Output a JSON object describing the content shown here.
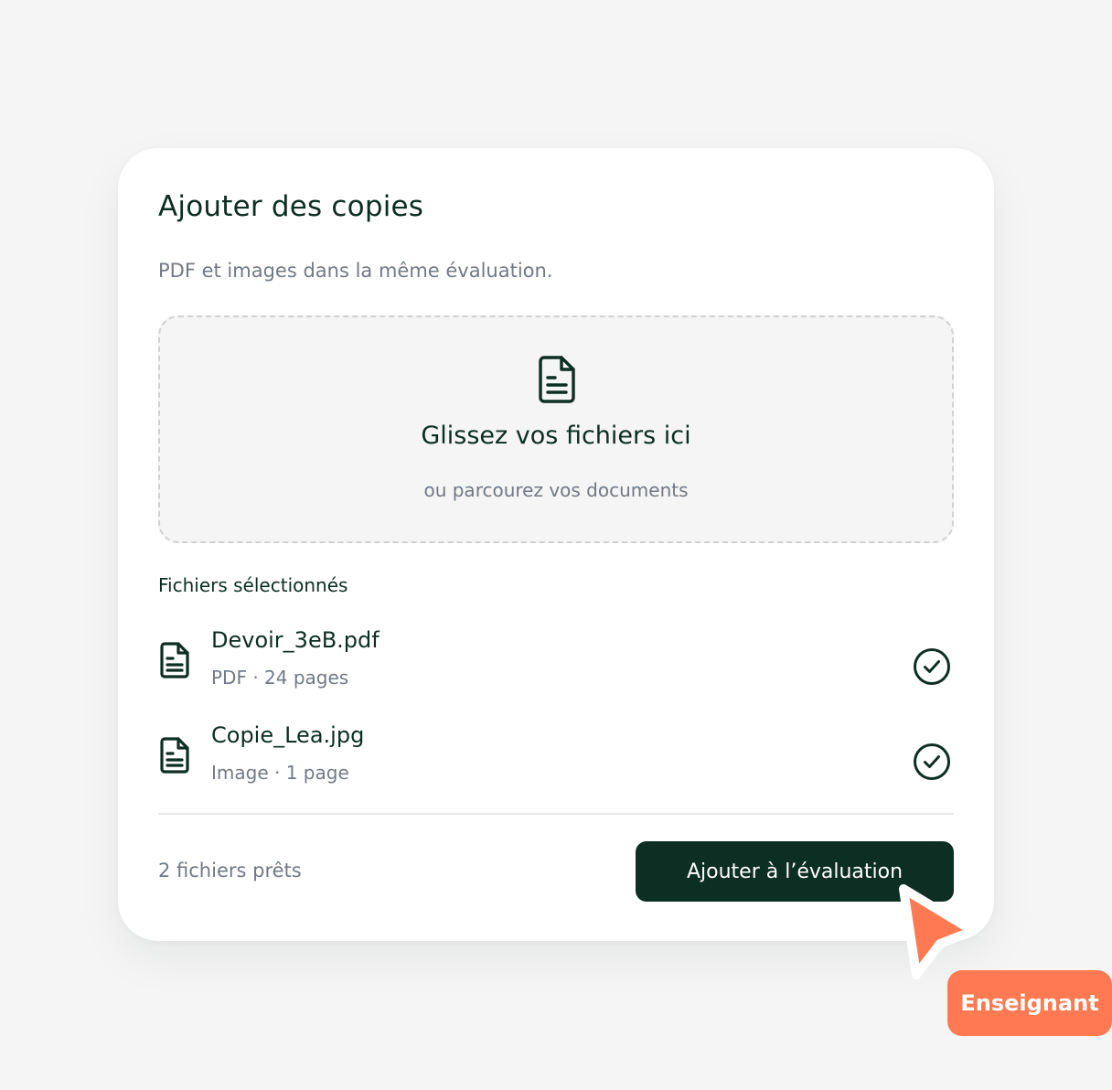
{
  "dialog": {
    "title": "Ajouter des copies",
    "subtitle": "PDF et images dans la même évaluation."
  },
  "dropzone": {
    "icon": "document-icon",
    "title": "Glissez vos fichiers ici",
    "subtitle": "ou parcourez vos documents"
  },
  "files": {
    "label": "Fichiers sélectionnés",
    "items": [
      {
        "name": "Devoir_3eB.pdf",
        "meta": "PDF · 24 pages",
        "icon": "document-icon",
        "status_icon": "check-circle-icon"
      },
      {
        "name": "Copie_Lea.jpg",
        "meta": "Image · 1 page",
        "icon": "document-icon",
        "status_icon": "check-circle-icon"
      }
    ]
  },
  "footer": {
    "status": "2 fichiers prêts",
    "submit_label": "Ajouter à l’évaluation"
  },
  "cursor": {
    "icon": "pointer-cursor-icon",
    "label": "Enseignant"
  },
  "colors": {
    "background": "#f4f5f4",
    "primary": "#0d2e22",
    "muted_text": "#727985",
    "accent": "#ff7a52",
    "card": "#ffffff"
  }
}
